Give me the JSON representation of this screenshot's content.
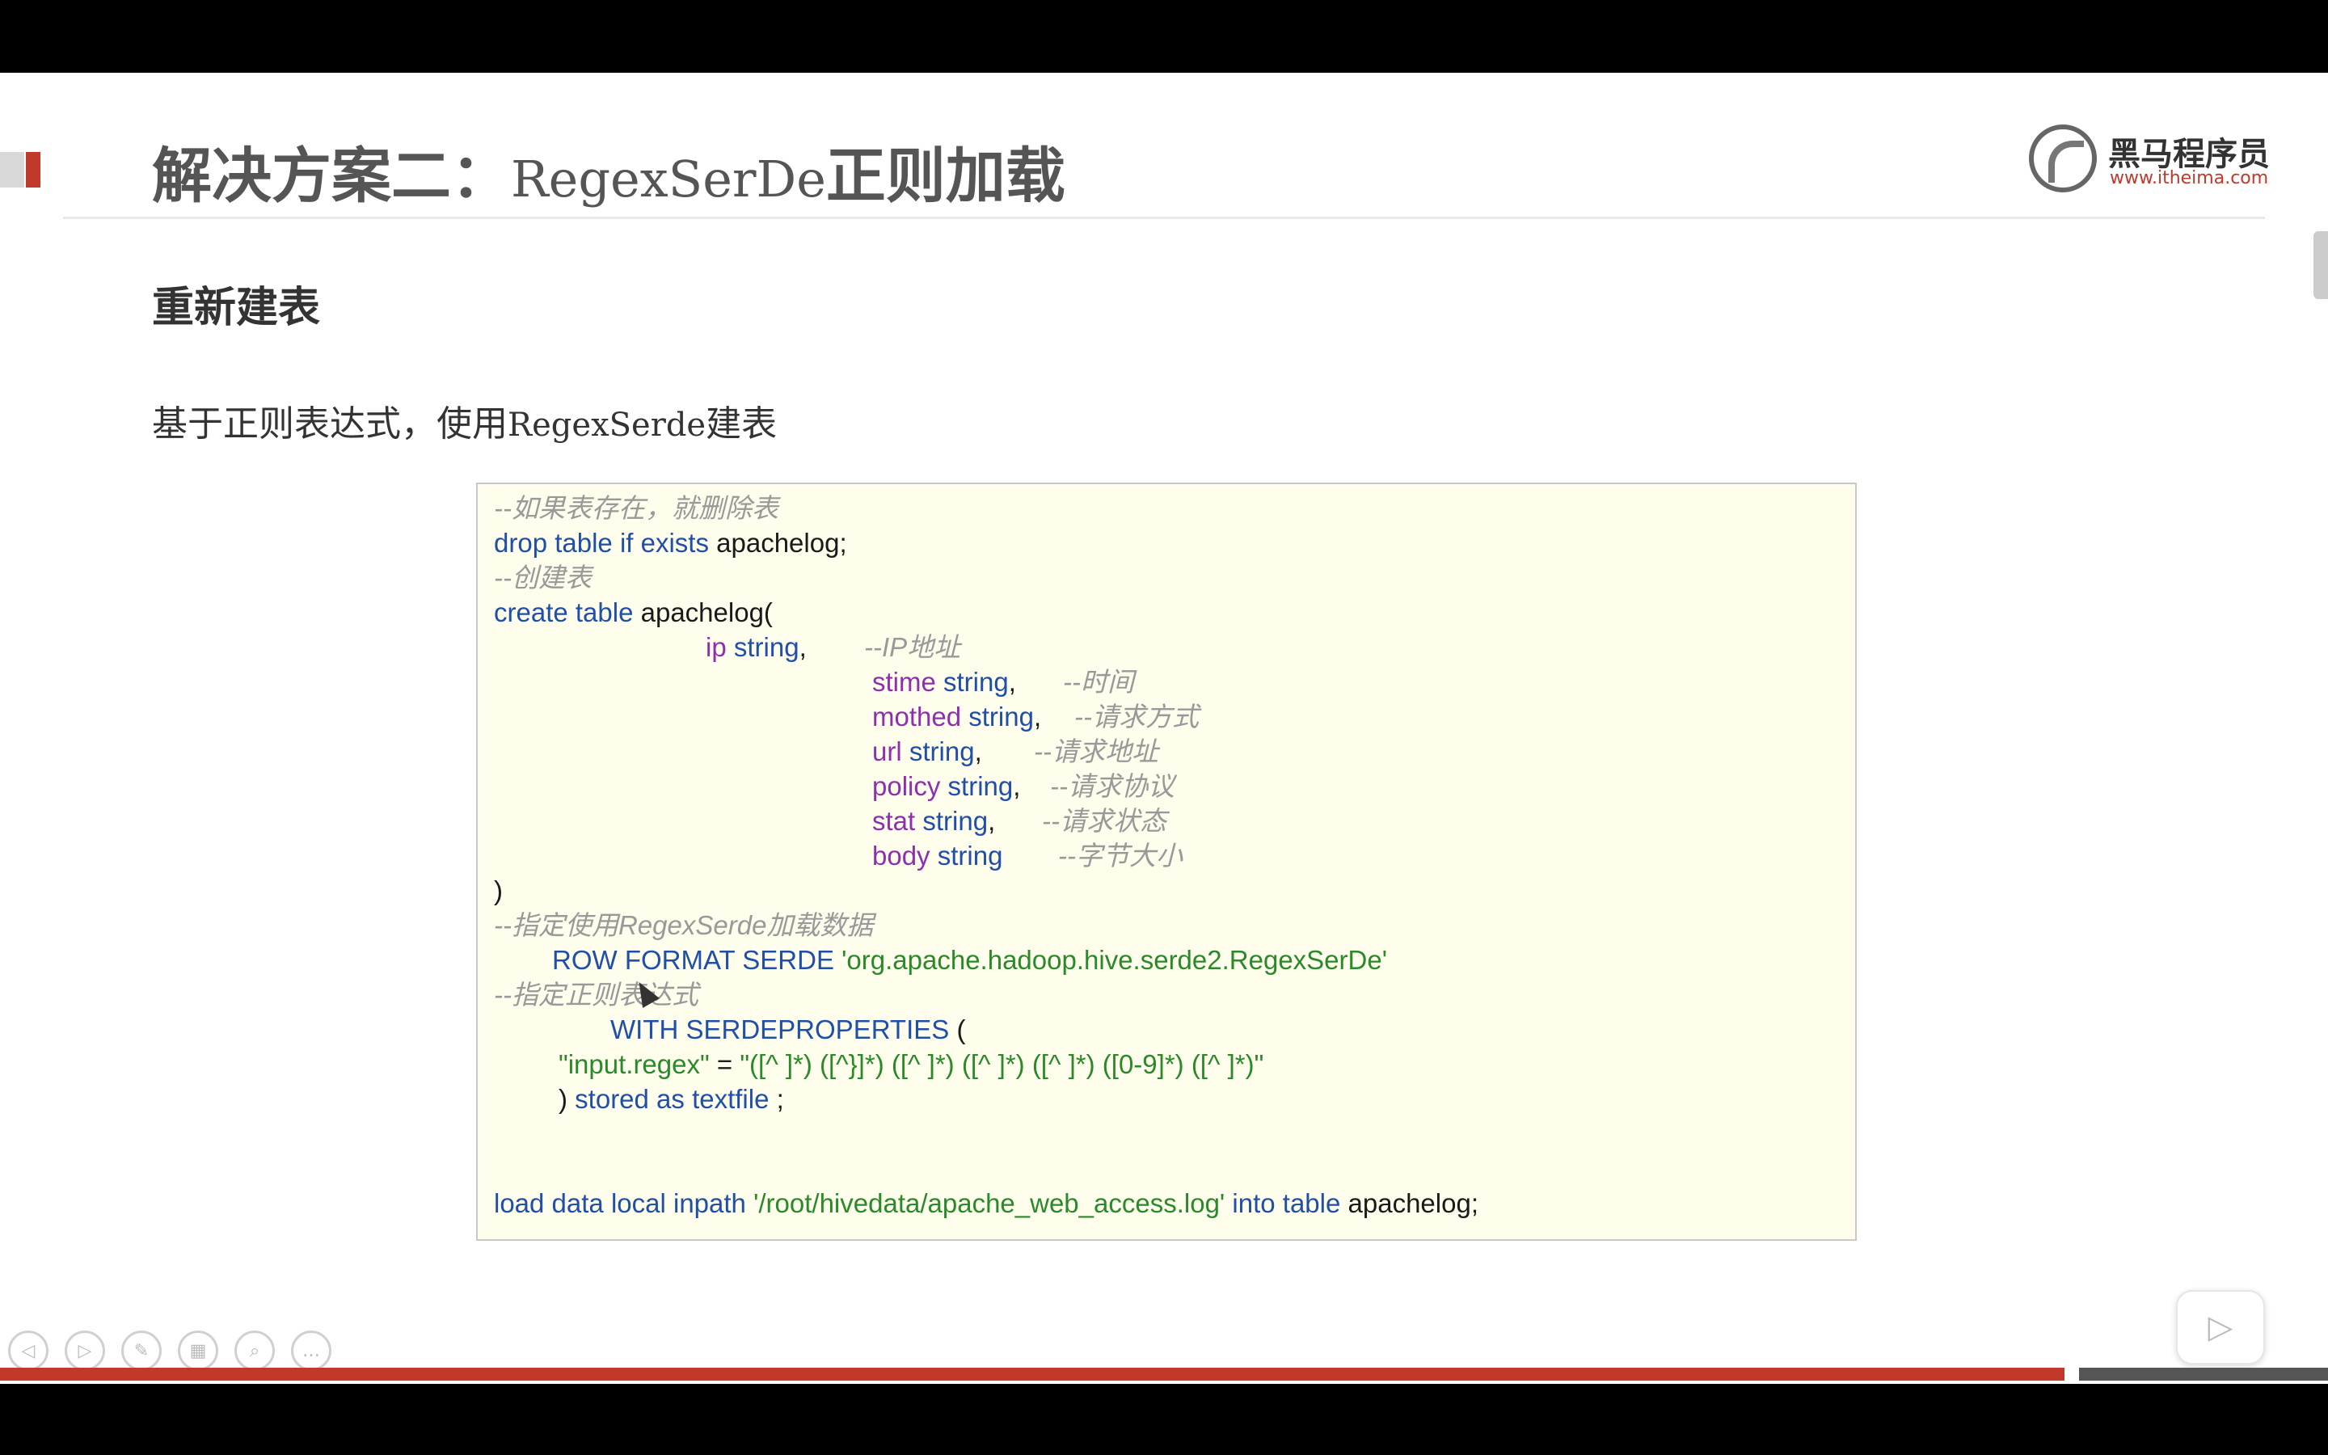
{
  "slide": {
    "title_cn_1": "解决方案二：",
    "title_mono": "RegexSerDe",
    "title_cn_2": "正则加载",
    "subtitle": "重新建表",
    "desc_cn_1": "基于正则表达式，使用",
    "desc_mono": "RegexSerde",
    "desc_cn_2": "建表",
    "logo_text": "黑马程序员",
    "logo_url": "www.itheima.com"
  },
  "code": {
    "l1": "--如果表存在，就删除表",
    "l2_kw": "drop table if exists",
    "l2_name": " apachelog;",
    "l3": "--创建表",
    "l4_kw": "create table",
    "l4_name": " apachelog(",
    "l5_col": "ip",
    "l5_type": " string",
    "l5_sep": ",",
    "l5_cmt": "--IP地址",
    "l6_col": "stime",
    "l6_type": " string",
    "l6_sep": ",",
    "l6_cmt": "--时间",
    "l7_col": "mothed",
    "l7_type": " string",
    "l7_sep": ",",
    "l7_cmt": "--请求方式",
    "l8_col": "url",
    "l8_type": " string",
    "l8_sep": ",",
    "l8_cmt": "--请求地址",
    "l9_col": "policy",
    "l9_type": " string",
    "l9_sep": ",",
    "l9_cmt": "--请求协议",
    "l10_col": "stat",
    "l10_type": " string",
    "l10_sep": ",",
    "l10_cmt": "--请求状态",
    "l11_col": "body",
    "l11_type": " string",
    "l11_cmt": "--字节大小",
    "l12": ")",
    "l13": "--指定使用RegexSerde加载数据",
    "l14_kw": "ROW FORMAT SERDE",
    "l14_str": " 'org.apache.hadoop.hive.serde2.RegexSerDe'",
    "l15": "--指定正则表达式",
    "l16_kw": "WITH SERDEPROPERTIES",
    "l16_p": " (",
    "l17_key": "\"input.regex\"",
    "l17_eq": " = ",
    "l17_val": "\"([^ ]*) ([^}]*) ([^ ]*) ([^ ]*) ([^ ]*) ([0-9]*) ([^ ]*)\"",
    "l18_p": ") ",
    "l18_kw": "stored as textfile",
    "l18_end": " ;",
    "l19_kw1": "load data local inpath",
    "l19_str": " '/root/hivedata/apache_web_access.log'",
    "l19_kw2": " into table",
    "l19_name": " apachelog;"
  },
  "controls": {
    "prev_icon": "◁",
    "next_icon": "▷",
    "pen_icon": "✎",
    "grid_icon": "▦",
    "zoom_icon": "⌕",
    "more_icon": "…",
    "play_icon": "▷"
  },
  "colors": {
    "accent_red": "#c0392b",
    "keyword_blue": "#1f4fa8",
    "column_purple": "#8e2fb0",
    "string_green": "#2a8a2a",
    "comment_grey": "#999999",
    "code_bg": "#fffdeb"
  }
}
